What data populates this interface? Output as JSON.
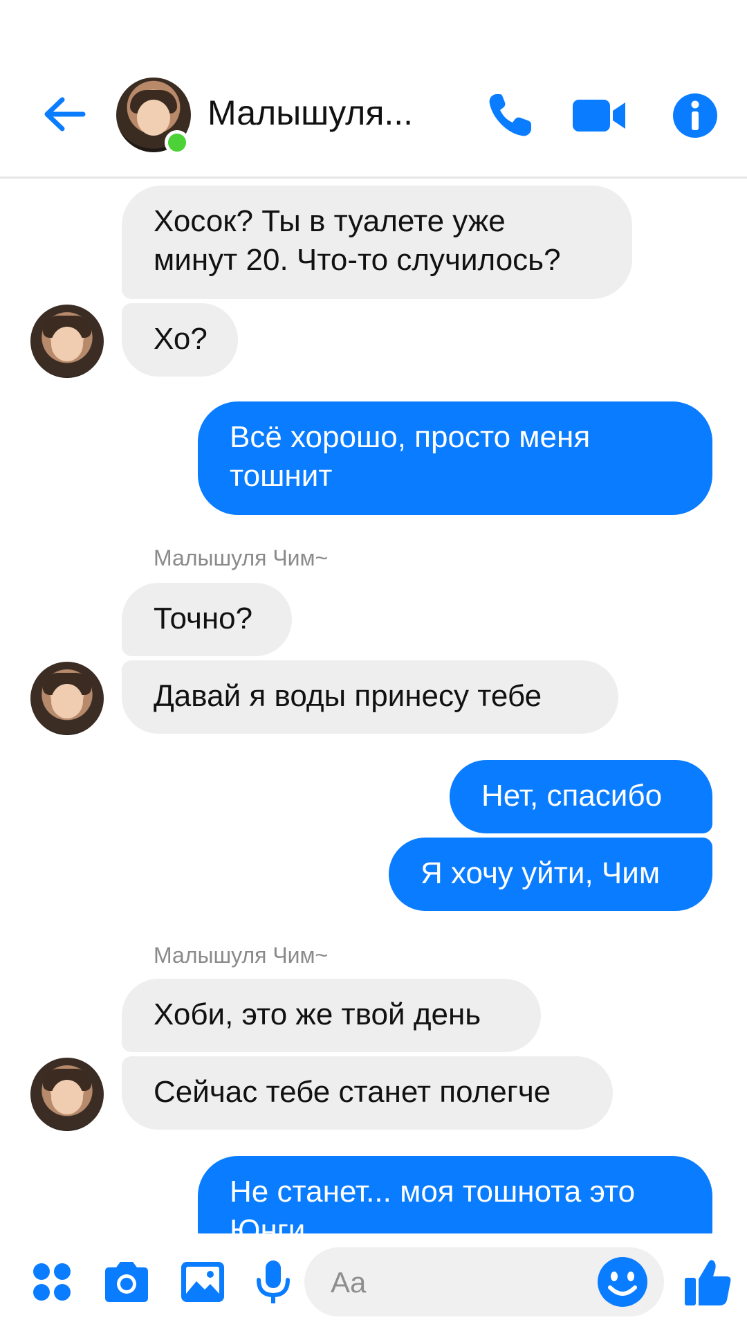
{
  "header": {
    "contact_name": "Малышуля...",
    "back_icon": "arrow-left-icon",
    "call_icon": "phone-icon",
    "video_icon": "video-camera-icon",
    "info_icon": "info-icon",
    "online": true,
    "accent_color": "#0a7cff"
  },
  "conversation": {
    "sender_name": "Малышуля Чим~",
    "messages": [
      {
        "from": "in",
        "text": "Хосок? Ты в туалете уже\nминут 20. Что-то случилось?"
      },
      {
        "from": "in",
        "text": "Хо?"
      },
      {
        "from": "out",
        "text": "Всё хорошо, просто меня\nтошнит"
      },
      {
        "from": "in",
        "text": "Точно?"
      },
      {
        "from": "in",
        "text": "Давай я воды принесу тебе"
      },
      {
        "from": "out",
        "text": "Нет, спасибо"
      },
      {
        "from": "out",
        "text": "Я хочу уйти, Чим"
      },
      {
        "from": "in",
        "text": "Хоби, это же твой день"
      },
      {
        "from": "in",
        "text": "Сейчас тебе станет полегче"
      },
      {
        "from": "out",
        "text": "Не станет... моя тошнота это\nЮнги"
      }
    ]
  },
  "composer": {
    "placeholder": "Aa",
    "icons": [
      "apps-grid-icon",
      "camera-icon",
      "gallery-image-icon",
      "microphone-icon",
      "emoji-icon",
      "thumbs-up-icon"
    ]
  }
}
